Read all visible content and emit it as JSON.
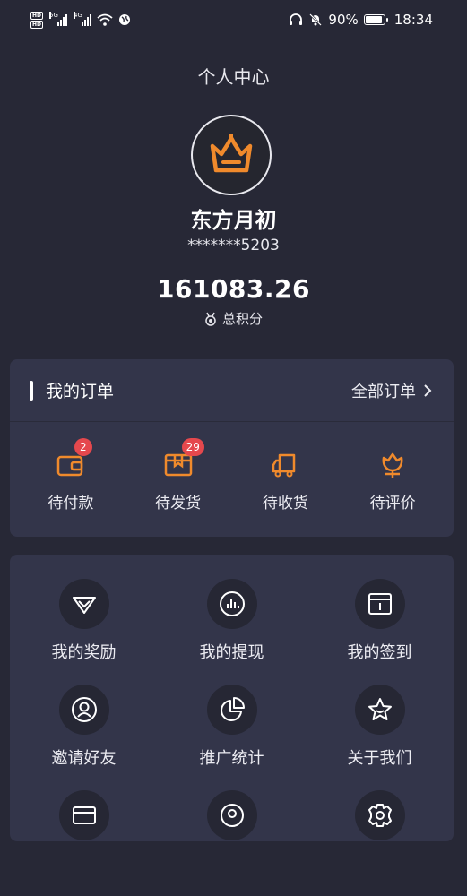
{
  "status_bar": {
    "signal1_label": "5G",
    "signal2_label": "4G",
    "battery_text": "90%",
    "battery_level": 0.9,
    "time": "18:34"
  },
  "header": {
    "title": "个人中心"
  },
  "profile": {
    "username": "东方月初",
    "phone": "*******5203",
    "points": "161083.26",
    "points_label": "总积分"
  },
  "orders": {
    "title": "我的订单",
    "all_label": "全部订单",
    "items": [
      {
        "label": "待付款",
        "icon": "wallet-icon",
        "badge": "2"
      },
      {
        "label": "待发货",
        "icon": "package-icon",
        "badge": "29"
      },
      {
        "label": "待收货",
        "icon": "truck-icon",
        "badge": ""
      },
      {
        "label": "待评价",
        "icon": "flower-icon",
        "badge": ""
      }
    ]
  },
  "menu": {
    "items": [
      {
        "label": "我的奖励",
        "icon": "diamond-icon"
      },
      {
        "label": "我的提现",
        "icon": "bar-chart-icon"
      },
      {
        "label": "我的签到",
        "icon": "calendar-icon"
      },
      {
        "label": "邀请好友",
        "icon": "user-icon"
      },
      {
        "label": "推广统计",
        "icon": "pie-chart-icon"
      },
      {
        "label": "关于我们",
        "icon": "star-icon"
      },
      {
        "label": "",
        "icon": "card-icon"
      },
      {
        "label": "",
        "icon": "location-icon"
      },
      {
        "label": "",
        "icon": "settings-icon"
      }
    ]
  },
  "colors": {
    "background": "#272836",
    "card": "#33354a",
    "accent": "#f08a2c",
    "badge": "#e5484d"
  }
}
